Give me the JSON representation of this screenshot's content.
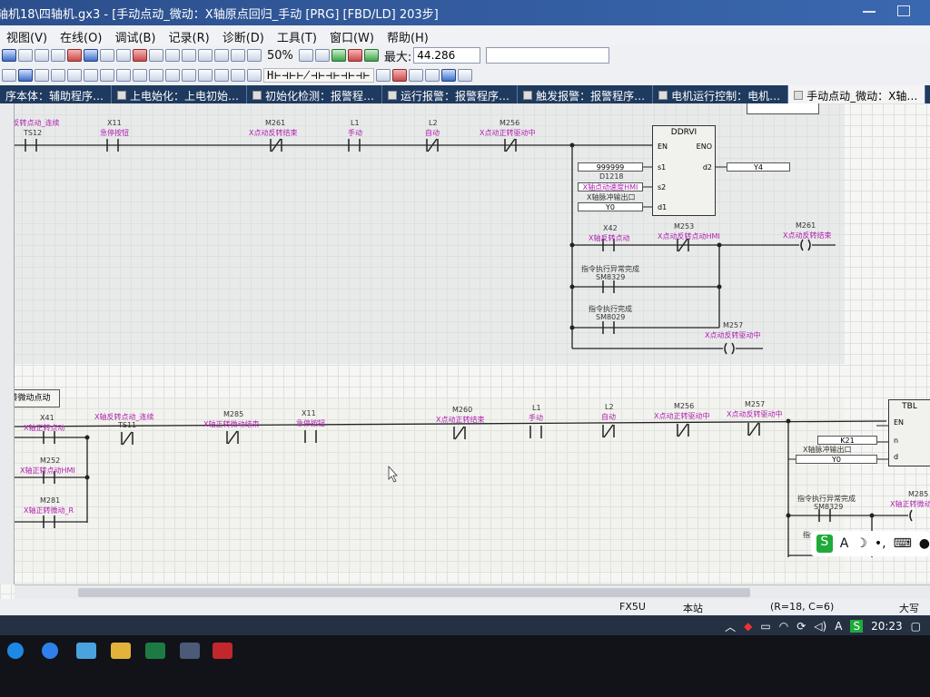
{
  "window": {
    "title": "轴机18\\四轴机.gx3 - [手动点动_微动：X轴原点回归_手动 [PRG] [FBD/LD] 203步]"
  },
  "menu": [
    "视图(V)",
    "在线(O)",
    "调试(B)",
    "记录(R)",
    "诊断(D)",
    "工具(T)",
    "窗口(W)",
    "帮助(H)"
  ],
  "toolbar": {
    "zoom": "50%",
    "max_label": "最大:",
    "max_value": "44.286",
    "ladder_symbols": "H⊢⊣⊢⊬⊣⊢⊣⊢⊣⊢⊣⊢"
  },
  "tabs": [
    {
      "label": "序本体：辅助程序…",
      "active": false
    },
    {
      "label": "上电始化：上电初始…",
      "active": false
    },
    {
      "label": "初始化检测：报警程…",
      "active": false
    },
    {
      "label": "运行报警：报警程序…",
      "active": false
    },
    {
      "label": "触发报警：报警程序…",
      "active": false
    },
    {
      "label": "电机运行控制：电机…",
      "active": false
    },
    {
      "label": "手动点动_微动：X轴…",
      "active": true
    }
  ],
  "rung1": {
    "contacts": [
      {
        "comment": "X轴反转点动_连续",
        "device": "TS12"
      },
      {
        "comment": "急停按钮",
        "device": "X11"
      },
      {
        "comment": "X点动反转结束",
        "device": "M261"
      },
      {
        "comment": "手动",
        "device": "L1"
      },
      {
        "comment": "自动",
        "device": "L2"
      },
      {
        "comment": "X点动正转驱动中",
        "device": "M256"
      }
    ],
    "fb": {
      "name": "DDRVI",
      "en": "EN",
      "eno": "ENO",
      "s1": "s1",
      "s2": "s2",
      "d1": "d1",
      "d2": "d2",
      "s1_value": "999999",
      "s1_device": "D1218",
      "s2_comment": "X轴点动速度HMI",
      "s2_comment2": "X轴脉冲输出口",
      "d1_value": "Y0",
      "d2_value": "Y4"
    },
    "branch": [
      {
        "comment": "X轴反转点动",
        "device": "X42"
      },
      {
        "comment": "X点动反转点动HMI",
        "device": "M253"
      },
      {
        "comment": "X点动反转结束",
        "device": "M261"
      },
      {
        "comment": "指令执行异常完成",
        "device": "SM8329"
      },
      {
        "comment": "指令执行完成",
        "device": "SM8029"
      },
      {
        "comment": "X点动反转驱动中",
        "device": "M257"
      }
    ]
  },
  "rung2": {
    "title": "转微动点动",
    "contacts": [
      {
        "comment": "X轴正转点动",
        "device": "X41"
      },
      {
        "comment": "X轴反转点动_连续",
        "device": "TS11"
      },
      {
        "comment": "X轴正转微动结束",
        "device": "M285"
      },
      {
        "comment": "急停按钮",
        "device": "X11"
      },
      {
        "comment": "X点动正转结束",
        "device": "M260"
      },
      {
        "comment": "手动",
        "device": "L1"
      },
      {
        "comment": "自动",
        "device": "L2"
      },
      {
        "comment": "X点动正转驱动中",
        "device": "M256"
      },
      {
        "comment": "X点动反转驱动中",
        "device": "M257"
      },
      {
        "comment": "X轴正转点动HMI",
        "device": "M252"
      },
      {
        "comment": "X轴正转微动_R",
        "device": "M281"
      }
    ],
    "fb": {
      "name": "TBL",
      "en": "EN",
      "n": "n",
      "d": "d",
      "n_value": "K21",
      "d_comment": "X轴脉冲输出口",
      "d_value": "Y0"
    },
    "branch": [
      {
        "comment": "指令执行异常完成",
        "device": "SM8329"
      },
      {
        "comment": "X轴正转微动",
        "device": "M285"
      },
      {
        "comment": "指令执行完成",
        "device": ""
      }
    ]
  },
  "status": {
    "plc": "FX5U",
    "station": "本站",
    "position": "(R=18, C=6)",
    "caps": "大写"
  },
  "taskbar": {
    "time": "20:23",
    "ime_label": "A"
  }
}
